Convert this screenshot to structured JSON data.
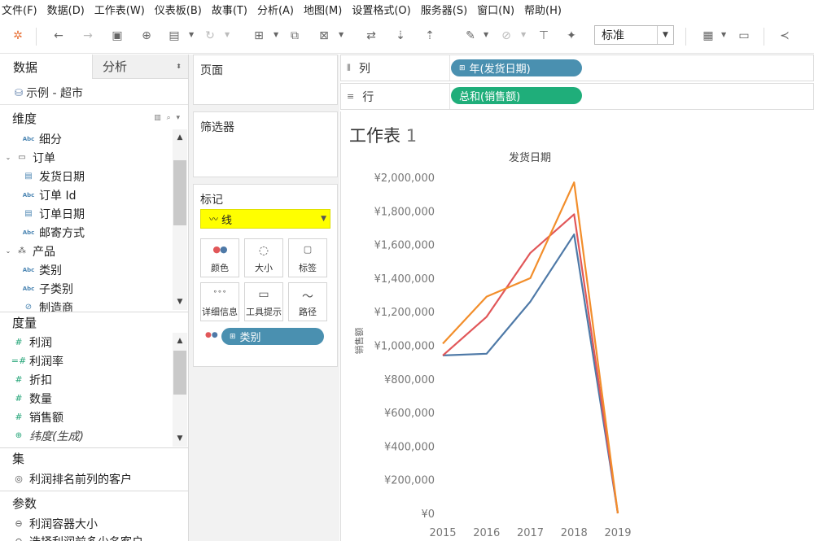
{
  "menu": [
    "文件(F)",
    "数据(D)",
    "工作表(W)",
    "仪表板(B)",
    "故事(T)",
    "分析(A)",
    "地图(M)",
    "设置格式(O)",
    "服务器(S)",
    "窗口(N)",
    "帮助(H)"
  ],
  "toolbar": {
    "fit_value": "标准"
  },
  "data_pane": {
    "tab_data": "数据",
    "tab_analysis": "分析",
    "datasource": "示例 - 超市",
    "dimensions_title": "维度",
    "dimensions": [
      {
        "label": "细分",
        "icon": "abc-icon",
        "indent": 1
      },
      {
        "label": "订单",
        "icon": "folder-icon",
        "indent": 0
      },
      {
        "label": "发货日期",
        "icon": "calendar-icon",
        "indent": 1
      },
      {
        "label": "订单 Id",
        "icon": "abc-icon",
        "indent": 1
      },
      {
        "label": "订单日期",
        "icon": "calendar-icon",
        "indent": 1
      },
      {
        "label": "邮寄方式",
        "icon": "abc-icon",
        "indent": 1
      },
      {
        "label": "产品",
        "icon": "hierarchy-icon",
        "indent": 0
      },
      {
        "label": "类别",
        "icon": "abc-icon",
        "indent": 1
      },
      {
        "label": "子类别",
        "icon": "abc-icon",
        "indent": 1
      },
      {
        "label": "制造商",
        "icon": "link-icon",
        "indent": 1
      }
    ],
    "measures_title": "度量",
    "measures": [
      {
        "label": "利润",
        "icon": "hash-icon",
        "italic": false
      },
      {
        "label": "利润率",
        "icon": "calc-icon",
        "italic": false
      },
      {
        "label": "折扣",
        "icon": "hash-icon",
        "italic": false
      },
      {
        "label": "数量",
        "icon": "hash-icon",
        "italic": false
      },
      {
        "label": "销售额",
        "icon": "hash-icon",
        "italic": false
      },
      {
        "label": "纬度(生成)",
        "icon": "globe-icon",
        "italic": true
      }
    ],
    "sets_title": "集",
    "sets": [
      "利润排名前列的客户"
    ],
    "params_title": "参数",
    "params": [
      "利润容器大小",
      "选择利润前多少名客户"
    ]
  },
  "cards": {
    "pages": "页面",
    "filters": "筛选器",
    "marks": "标记",
    "mark_type": "线",
    "mark_buttons": [
      "颜色",
      "大小",
      "标签",
      "详细信息",
      "工具提示",
      "路径"
    ],
    "color_pill": "类别"
  },
  "shelves": {
    "columns_label": "列",
    "columns_pill": "年(发货日期)",
    "rows_label": "行",
    "rows_pill": "总和(销售额)"
  },
  "sheet": {
    "title": "工作表",
    "number": "1"
  },
  "colors": {
    "series": [
      "#4e79a7",
      "#e15759",
      "#f28e2b"
    ],
    "pill_blue": "#4a90b0",
    "pill_green": "#1fae7a",
    "highlight": "#ffff00"
  },
  "chart_data": {
    "type": "line",
    "title": "发货日期",
    "xlabel": "",
    "ylabel": "销售额",
    "x": [
      "2015",
      "2016",
      "2017",
      "2018",
      "2019"
    ],
    "ylim": [
      0,
      2000000
    ],
    "yticks": [
      "¥0",
      "¥200,000",
      "¥400,000",
      "¥600,000",
      "¥800,000",
      "¥1,000,000",
      "¥1,200,000",
      "¥1,400,000",
      "¥1,600,000",
      "¥1,800,000",
      "¥2,000,000"
    ],
    "ytick_values": [
      0,
      200000,
      400000,
      600000,
      800000,
      1000000,
      1200000,
      1400000,
      1600000,
      1800000,
      2000000
    ],
    "series": [
      {
        "values": [
          940000,
          950000,
          1260000,
          1660000,
          0
        ]
      },
      {
        "values": [
          940000,
          1170000,
          1550000,
          1780000,
          0
        ]
      },
      {
        "values": [
          1010000,
          1290000,
          1400000,
          1970000,
          0
        ]
      }
    ],
    "grid": false
  }
}
